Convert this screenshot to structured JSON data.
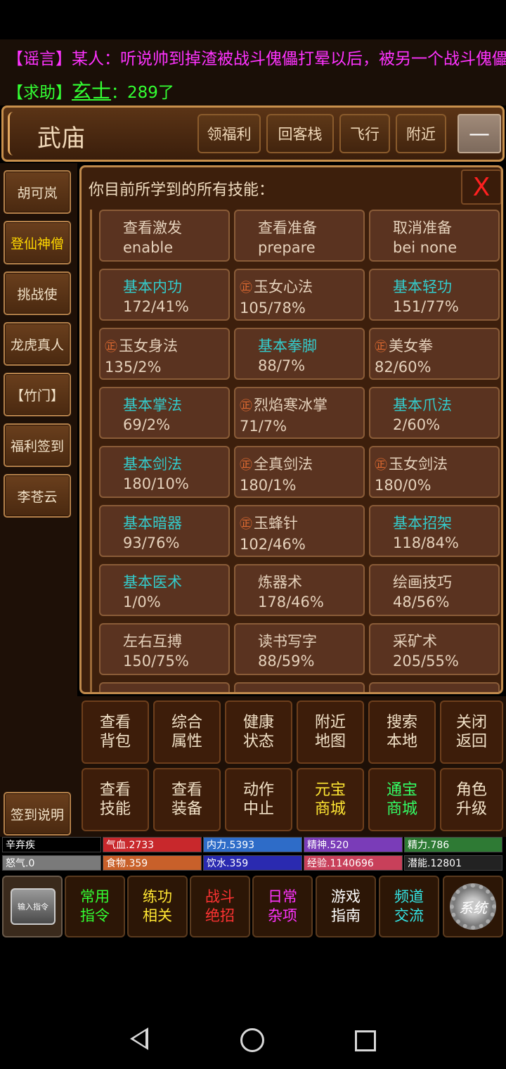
{
  "chat": {
    "line1": "【谣言】某人：听说帅到掉渣被战斗傀儡打晕以后，被另一个战斗傀儡",
    "line2_prefix": "【求助】",
    "line2_name": "玄士",
    "line2_suffix": "：289了"
  },
  "location": {
    "title": "武庙",
    "buttons": [
      "领福利",
      "回客栈",
      "飞行",
      "附近"
    ],
    "minimize": "—"
  },
  "sidebar": {
    "items": [
      "胡可岚",
      "登仙神僧",
      "挑战使",
      "龙虎真人",
      "【竹门】",
      "福利签到",
      "李苍云"
    ],
    "bottom": "签到说明"
  },
  "panel": {
    "title": "你目前所学到的所有技能：",
    "close": "X",
    "skills": [
      {
        "name": "查看激发",
        "sub": "enable",
        "kind": "cmd"
      },
      {
        "name": "查看准备",
        "sub": "prepare",
        "kind": "cmd"
      },
      {
        "name": "取消准备",
        "sub": "bei none",
        "kind": "cmd"
      },
      {
        "name": "基本内功",
        "sub": "172/41%",
        "kind": "basic"
      },
      {
        "name": "玉女心法",
        "sub": "105/78%",
        "kind": "special"
      },
      {
        "name": "基本轻功",
        "sub": "151/77%",
        "kind": "basic"
      },
      {
        "name": "玉女身法",
        "sub": "135/2%",
        "kind": "special"
      },
      {
        "name": "基本拳脚",
        "sub": "88/7%",
        "kind": "basic"
      },
      {
        "name": "美女拳",
        "sub": "82/60%",
        "kind": "special"
      },
      {
        "name": "基本掌法",
        "sub": "69/2%",
        "kind": "basic"
      },
      {
        "name": "烈焰寒冰掌",
        "sub": "71/7%",
        "kind": "special"
      },
      {
        "name": "基本爪法",
        "sub": "2/60%",
        "kind": "basic"
      },
      {
        "name": "基本剑法",
        "sub": "180/10%",
        "kind": "basic"
      },
      {
        "name": "全真剑法",
        "sub": "180/1%",
        "kind": "special"
      },
      {
        "name": "玉女剑法",
        "sub": "180/0%",
        "kind": "special"
      },
      {
        "name": "基本暗器",
        "sub": "93/76%",
        "kind": "basic"
      },
      {
        "name": "玉蜂针",
        "sub": "102/46%",
        "kind": "special"
      },
      {
        "name": "基本招架",
        "sub": "118/84%",
        "kind": "basic"
      },
      {
        "name": "基本医术",
        "sub": "1/0%",
        "kind": "basic"
      },
      {
        "name": "炼器术",
        "sub": "178/46%",
        "kind": "other"
      },
      {
        "name": "绘画技巧",
        "sub": "48/56%",
        "kind": "other"
      },
      {
        "name": "左右互搏",
        "sub": "150/75%",
        "kind": "other"
      },
      {
        "name": "读书写字",
        "sub": "88/59%",
        "kind": "other"
      },
      {
        "name": "采矿术",
        "sub": "205/55%",
        "kind": "other"
      }
    ]
  },
  "commands": [
    {
      "l1": "查看",
      "l2": "背包",
      "color": "normal"
    },
    {
      "l1": "综合",
      "l2": "属性",
      "color": "normal"
    },
    {
      "l1": "健康",
      "l2": "状态",
      "color": "normal"
    },
    {
      "l1": "附近",
      "l2": "地图",
      "color": "normal"
    },
    {
      "l1": "搜索",
      "l2": "本地",
      "color": "normal"
    },
    {
      "l1": "关闭",
      "l2": "返回",
      "color": "normal"
    },
    {
      "l1": "查看",
      "l2": "技能",
      "color": "normal"
    },
    {
      "l1": "查看",
      "l2": "装备",
      "color": "normal"
    },
    {
      "l1": "动作",
      "l2": "中止",
      "color": "normal"
    },
    {
      "l1": "元宝",
      "l2": "商城",
      "color": "yellow"
    },
    {
      "l1": "通宝",
      "l2": "商城",
      "color": "green"
    },
    {
      "l1": "角色",
      "l2": "升级",
      "color": "normal"
    }
  ],
  "stats": [
    {
      "label": "辛弃疾",
      "color": "#000000"
    },
    {
      "label": "气血.2733",
      "color": "#c8282c"
    },
    {
      "label": "内力.5393",
      "color": "#2e6cc8"
    },
    {
      "label": "精神.520",
      "color": "#7a3cb8"
    },
    {
      "label": "精力.786",
      "color": "#2e7a34"
    },
    {
      "label": "",
      "color": "#000000"
    },
    {
      "label": "怒气.0",
      "color": "#7a7a7a"
    },
    {
      "label": "食物.359",
      "color": "#c8602a"
    },
    {
      "label": "饮水.359",
      "color": "#2a2ab0"
    },
    {
      "label": "经验.1140696",
      "color": "#c8405a"
    },
    {
      "label": "潜能.12801",
      "color": "#222222"
    }
  ],
  "bottom_menu": {
    "input_label": "输入指令",
    "items": [
      {
        "l1": "常用",
        "l2": "指令",
        "color": "#33ff33"
      },
      {
        "l1": "练功",
        "l2": "相关",
        "color": "#ffe633"
      },
      {
        "l1": "战斗",
        "l2": "绝招",
        "color": "#ff3333"
      },
      {
        "l1": "日常",
        "l2": "杂项",
        "color": "#ff33ff"
      },
      {
        "l1": "游戏",
        "l2": "指南",
        "color": "#ffffff"
      },
      {
        "l1": "频道",
        "l2": "交流",
        "color": "#33e6e6"
      }
    ],
    "system_label": "系统"
  }
}
